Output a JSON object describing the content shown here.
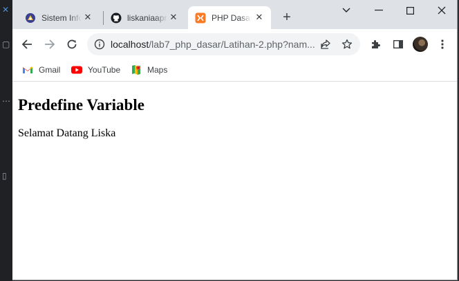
{
  "browser": {
    "tabs": [
      {
        "title": "Sistem Informasi",
        "favicon": "university-logo-icon",
        "active": false
      },
      {
        "title": "liskaniaaprilia",
        "favicon": "github-icon",
        "active": false
      },
      {
        "title": "PHP Dasar",
        "favicon": "xampp-icon",
        "active": true
      }
    ],
    "close_symbol": "✕",
    "new_tab_symbol": "+",
    "address": {
      "host": "localhost",
      "path": "/lab7_php_dasar/Latihan-2.php?nam..."
    },
    "bookmarks": [
      {
        "label": "Gmail",
        "icon": "gmail-icon"
      },
      {
        "label": "YouTube",
        "icon": "youtube-icon"
      },
      {
        "label": "Maps",
        "icon": "maps-icon"
      }
    ],
    "colors": {
      "tabbar": "#dee1e6",
      "active_tab": "#ffffff",
      "omnibox": "#f1f3f4"
    }
  },
  "page": {
    "heading": "Predefine Variable",
    "greeting": "Selamat Datang Liska"
  }
}
